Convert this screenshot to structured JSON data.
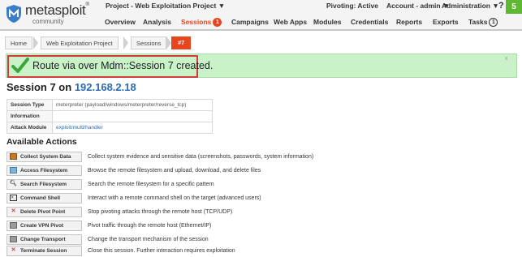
{
  "app": {
    "logo_text": "metasploit",
    "logo_sup": "®",
    "logo_sub": "community",
    "project_title": "Project - Web Exploitation Project ▼",
    "pivoting": "Pivoting: Active",
    "account": "Account - admin ▼",
    "administration": "Administration ▼",
    "help": "?",
    "right_badge": "5"
  },
  "nav": {
    "items": [
      {
        "label": "Overview"
      },
      {
        "label": "Analysis"
      },
      {
        "label": "Sessions",
        "badge": "1"
      },
      {
        "label": "Campaigns"
      },
      {
        "label": "Web Apps"
      },
      {
        "label": "Modules"
      },
      {
        "label": "Credentials"
      },
      {
        "label": "Reports"
      },
      {
        "label": "Exports"
      },
      {
        "label": "Tasks",
        "badge": "1"
      }
    ]
  },
  "breadcrumb": [
    "Home",
    "Web Exploitation Project",
    "Sessions",
    "#7"
  ],
  "flash": {
    "message": "Route via over Mdm::Session 7 created.",
    "close": "x"
  },
  "session": {
    "title_prefix": "Session 7 on ",
    "ip": "192.168.2.18",
    "info": [
      {
        "key": "Session Type",
        "value": "meterpreter (payload/windows/meterpreter/reverse_tcp)"
      },
      {
        "key": "Information",
        "value": ""
      },
      {
        "key": "Attack Module",
        "value": "exploit/multi/handler"
      }
    ]
  },
  "actions": {
    "title": "Available Actions",
    "items": [
      {
        "icon": "collect-data-icon",
        "label": "Collect System Data",
        "desc": "Collect system evidence and sensitive data (screenshots, passwords, system information)"
      },
      {
        "icon": "filesystem-icon",
        "label": "Access Filesystem",
        "desc": "Browse the remote filesystem and upload, download, and delete files"
      },
      {
        "icon": "search-icon",
        "label": "Search Filesystem",
        "desc": "Search the remote filesystem for a specific pattern"
      },
      {
        "icon": "terminal-icon",
        "label": "Command Shell",
        "desc": "Interact with a remote command shell on the target (advanced users)"
      },
      {
        "icon": "delete-icon",
        "label": "Delete Pivot Point",
        "desc": "Stop pivoting attacks through the remote host (TCP/UDP)"
      },
      {
        "icon": "vpn-icon",
        "label": "Create VPN Pivot",
        "desc": "Pivot traffic through the remote host (Ethernet/IP)"
      },
      {
        "icon": "transport-icon",
        "label": "Change Transport",
        "desc": "Change the transport mechanism of the session"
      },
      {
        "icon": "close-icon",
        "label": "Terminate Session",
        "desc": "Close this session. Further interaction requires exploitation"
      }
    ]
  }
}
